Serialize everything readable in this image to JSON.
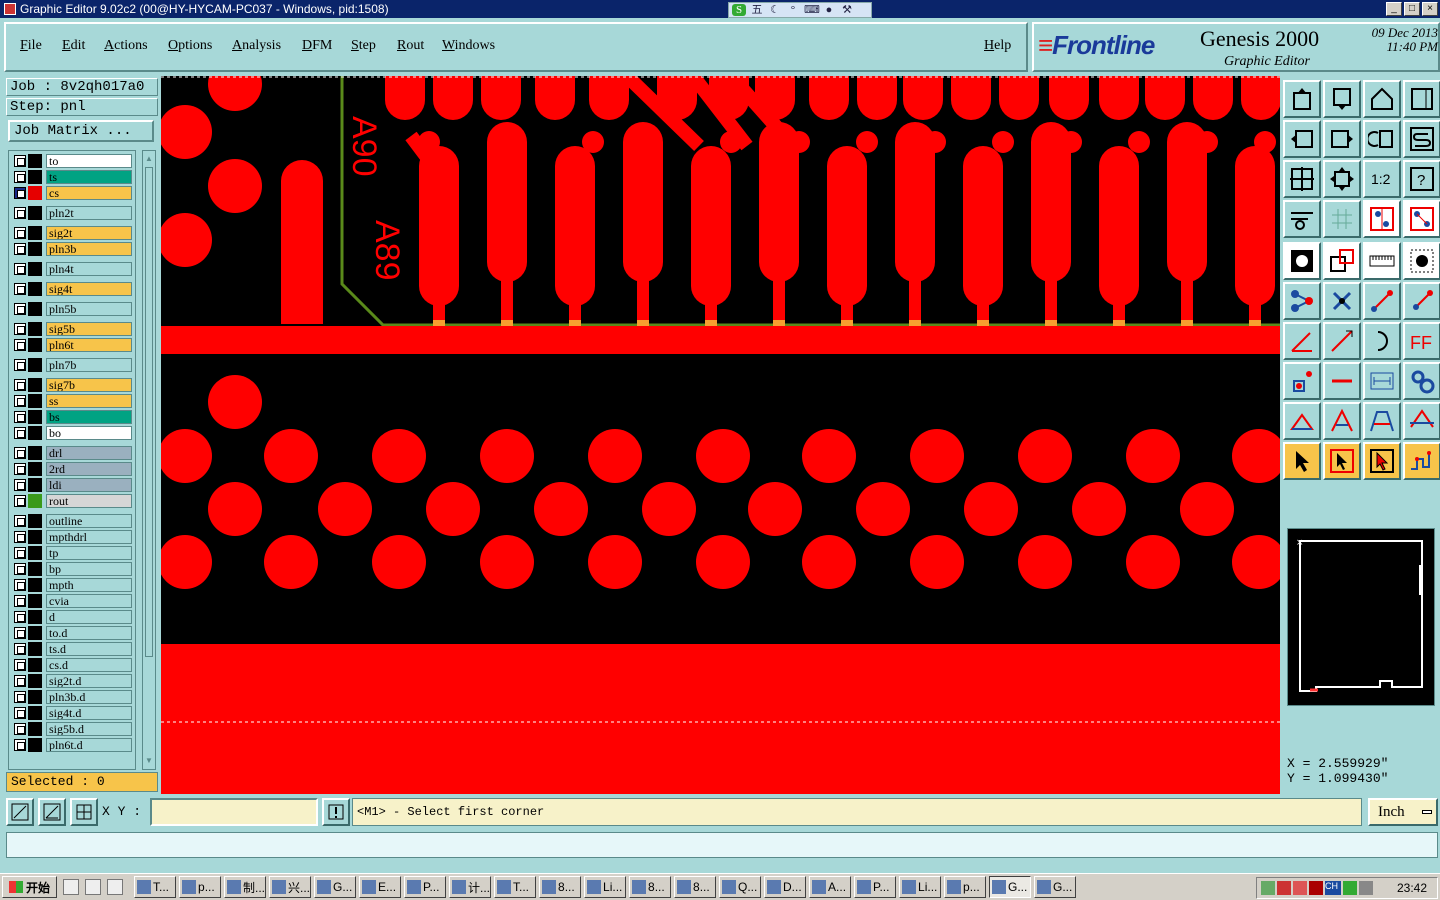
{
  "window": {
    "title": "Graphic Editor 9.02c2 (00@HY-HYCAM-PC037 - Windows, pid:1508)",
    "controls": [
      "_",
      "□",
      "×"
    ]
  },
  "ime_bar": {
    "mode": "五"
  },
  "menu": {
    "items": [
      "File",
      "Edit",
      "Actions",
      "Options",
      "Analysis",
      "DFM",
      "Step",
      "Rout",
      "Windows"
    ],
    "help": "Help"
  },
  "logo": {
    "brand": "Frontline",
    "product": "Genesis 2000",
    "subtitle": "Graphic Editor",
    "date": "09 Dec 2013",
    "time": "11:40 PM"
  },
  "job": {
    "job_label": "Job : 8v2qh017a0",
    "step_label": "Step: pnl",
    "matrix_button": "Job Matrix ..."
  },
  "layers": [
    {
      "name": "to",
      "color": "#ffffff",
      "swatch": "#000000"
    },
    {
      "name": "ts",
      "color": "#00a383",
      "swatch": "#000000"
    },
    {
      "name": "cs",
      "color": "#f7c44a",
      "swatch": "#e60000",
      "active": true
    },
    {
      "name": "pln2t",
      "color": "#a7d8d8",
      "swatch": "#000000"
    },
    {
      "name": "sig2t",
      "color": "#f7c44a",
      "swatch": "#000000"
    },
    {
      "name": "pln3b",
      "color": "#f7c44a",
      "swatch": "#000000"
    },
    {
      "name": "pln4t",
      "color": "#a7d8d8",
      "swatch": "#000000"
    },
    {
      "name": "sig4t",
      "color": "#f7c44a",
      "swatch": "#000000"
    },
    {
      "name": "pln5b",
      "color": "#a7d8d8",
      "swatch": "#000000"
    },
    {
      "name": "sig5b",
      "color": "#f7c44a",
      "swatch": "#000000"
    },
    {
      "name": "pln6t",
      "color": "#f7c44a",
      "swatch": "#000000"
    },
    {
      "name": "pln7b",
      "color": "#a7d8d8",
      "swatch": "#000000"
    },
    {
      "name": "sig7b",
      "color": "#f7c44a",
      "swatch": "#000000"
    },
    {
      "name": "ss",
      "color": "#f7c44a",
      "swatch": "#000000"
    },
    {
      "name": "bs",
      "color": "#00a383",
      "swatch": "#000000"
    },
    {
      "name": "bo",
      "color": "#ffffff",
      "swatch": "#000000"
    },
    {
      "name": "drl",
      "color": "#9ab0bf",
      "swatch": "#000000"
    },
    {
      "name": "2rd",
      "color": "#9ab0bf",
      "swatch": "#000000"
    },
    {
      "name": "ldi",
      "color": "#9ab0bf",
      "swatch": "#000000"
    },
    {
      "name": "rout",
      "color": "#d6d6d6",
      "swatch": "#3a9a1a"
    },
    {
      "name": "outline",
      "color": "#a7d8d8",
      "swatch": "#000000"
    },
    {
      "name": "mpthdrl",
      "color": "#a7d8d8",
      "swatch": "#000000"
    },
    {
      "name": "tp",
      "color": "#a7d8d8",
      "swatch": "#000000"
    },
    {
      "name": "bp",
      "color": "#a7d8d8",
      "swatch": "#000000"
    },
    {
      "name": "mpth",
      "color": "#a7d8d8",
      "swatch": "#000000"
    },
    {
      "name": "cvia",
      "color": "#a7d8d8",
      "swatch": "#000000"
    },
    {
      "name": "d",
      "color": "#a7d8d8",
      "swatch": "#000000"
    },
    {
      "name": "to.d",
      "color": "#a7d8d8",
      "swatch": "#000000"
    },
    {
      "name": "ts.d",
      "color": "#a7d8d8",
      "swatch": "#000000"
    },
    {
      "name": "cs.d",
      "color": "#a7d8d8",
      "swatch": "#000000"
    },
    {
      "name": "sig2t.d",
      "color": "#a7d8d8",
      "swatch": "#000000"
    },
    {
      "name": "pln3b.d",
      "color": "#a7d8d8",
      "swatch": "#000000"
    },
    {
      "name": "sig4t.d",
      "color": "#a7d8d8",
      "swatch": "#000000"
    },
    {
      "name": "sig5b.d",
      "color": "#a7d8d8",
      "swatch": "#000000"
    },
    {
      "name": "pln6t.d",
      "color": "#a7d8d8",
      "swatch": "#000000"
    }
  ],
  "selected_label": "Selected : 0",
  "canvas": {
    "background": "#000000",
    "copper_color": "#ff0000",
    "outline_color": "#5a8a1a",
    "labels": [
      "A90",
      "A89"
    ]
  },
  "toolbox": {
    "rows": [
      [
        "view-top-icon",
        "view-down-icon",
        "home-icon",
        "window-icon"
      ],
      [
        "pan-left-icon",
        "pan-right-icon",
        "zoom-cycle-icon",
        "s-curve-icon"
      ],
      [
        "fit-icon",
        "center-icon",
        "one-to-one-icon",
        "help-query-icon"
      ],
      [
        "snap-tools-icon",
        "grid-icon",
        "snap-a-icon",
        "snap-b-icon"
      ],
      [
        "pad-select-icon",
        "pad-outline-icon",
        "ruler-icon",
        "dot-icon"
      ],
      [
        "route-node-icon",
        "cross-icon",
        "line-node-icon",
        "line-node-b-icon"
      ],
      [
        "angle-icon",
        "diagonal-icon",
        "arc-icon",
        "font-icon"
      ],
      [
        "pad-node-icon",
        "minus-icon",
        "measure-icon",
        "circles-icon"
      ],
      [
        "triangle-small-icon",
        "triangle-icon",
        "trapezoid-icon",
        "triangle-line-icon"
      ],
      [
        "pointer-icon",
        "pointer-box-icon",
        "pointer-rect-icon",
        "wave-icon"
      ]
    ],
    "active": [
      "snap-a-icon",
      "snap-b-icon"
    ]
  },
  "coords": {
    "x": "X = 2.559929\"",
    "y": "Y = 1.099430\""
  },
  "command": {
    "xy_label": "X Y :",
    "xy_value": "",
    "prompt": "<M1> - Select first corner",
    "units": "Inch"
  },
  "taskbar": {
    "start": "开始",
    "tasks": [
      "T...",
      "p...",
      "制...",
      "兴...",
      "G...",
      "E...",
      "P...",
      "计...",
      "T...",
      "8...",
      "Li...",
      "8...",
      "8...",
      "Q...",
      "D...",
      "A...",
      "P...",
      "Li...",
      "p...",
      "G...",
      "G..."
    ],
    "active_task": 19,
    "tray_lang": "CH",
    "clock": "23:42"
  }
}
